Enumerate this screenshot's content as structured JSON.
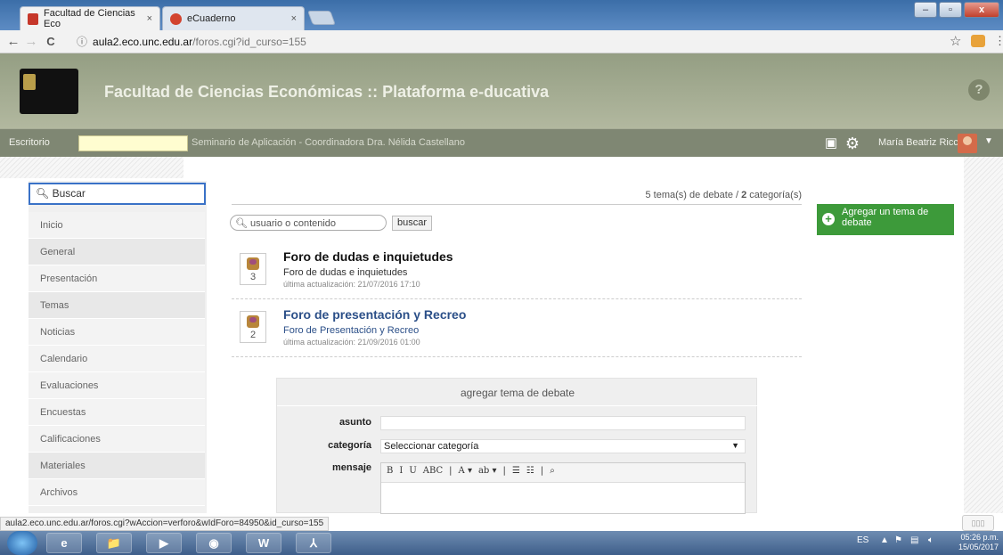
{
  "browser": {
    "tabs": [
      {
        "label": "Facultad de Ciencias Eco",
        "close": "×"
      },
      {
        "label": "eCuaderno",
        "close": "×"
      }
    ],
    "url_host": "aula2.eco.unc.edu.ar",
    "url_path": "/foros.cgi?id_curso=155",
    "info_icon": "ⓘ",
    "back": "←",
    "forward": "→",
    "reload": "C",
    "star": "☆",
    "menu": "⋮",
    "window": {
      "minimize": "–",
      "maximize": "▫",
      "close": "x"
    }
  },
  "header": {
    "logo_text": "Facultad de Ciencias Económicas Universidad Nacional de Córdoba",
    "title": "Facultad de Ciencias Económicas :: Plataforma e-ducativa",
    "help": "?"
  },
  "navbar": {
    "escritorio": "Escritorio",
    "course": "Seminario de Aplicación - Coordinadora Dra. Nélida Castellano",
    "user": "María Beatriz Ricci",
    "caret": "▼"
  },
  "sidebar": {
    "search_placeholder": "Buscar",
    "items": [
      {
        "label": "Inicio",
        "alt": false
      },
      {
        "label": "General",
        "alt": true
      },
      {
        "label": "Presentación",
        "alt": false
      },
      {
        "label": "Temas",
        "alt": true
      },
      {
        "label": "Noticias",
        "alt": false
      },
      {
        "label": "Calendario",
        "alt": false
      },
      {
        "label": "Evaluaciones",
        "alt": false
      },
      {
        "label": "Encuestas",
        "alt": false
      },
      {
        "label": "Calificaciones",
        "alt": false
      },
      {
        "label": "Materiales",
        "alt": true
      },
      {
        "label": "Archivos",
        "alt": false
      }
    ]
  },
  "main": {
    "count_prefix": "5 tema(s) de debate / ",
    "count_bold": "2",
    "count_suffix": " categoría(s)",
    "search_placeholder": "usuario o contenido",
    "search_button": "buscar",
    "add_topic": "Agregar un tema de debate",
    "forums": [
      {
        "title": "Foro de dudas e inquietudes",
        "desc": "Foro de dudas e inquietudes",
        "updated": "última actualización: 21/07/2016 17:10",
        "count": "3"
      },
      {
        "title": "Foro de presentación y Recreo",
        "desc": "Foro de Presentación y Recreo",
        "updated": "última actualización: 21/09/2016 01:00",
        "count": "2"
      }
    ]
  },
  "form": {
    "title": "agregar tema de debate",
    "subject_label": "asunto",
    "category_label": "categoría",
    "category_value": "Seleccionar categoría",
    "message_label": "mensaje",
    "toolbar": [
      "B",
      "I",
      "U",
      "ABC",
      "|",
      "A ▾",
      "ab ▾",
      "|",
      "☰",
      "☷",
      "|",
      "⌕"
    ]
  },
  "status_url": "aula2.eco.unc.edu.ar/foros.cgi?wAccion=verforo&wIdForo=84950&id_curso=155",
  "corner_button": "▯▯▯",
  "taskbar": {
    "lang": "ES",
    "time": "05:26 p.m.",
    "date": "15/05/2017",
    "apps": [
      "e",
      "📁",
      "▶",
      "◉",
      "W",
      "⅄"
    ]
  }
}
